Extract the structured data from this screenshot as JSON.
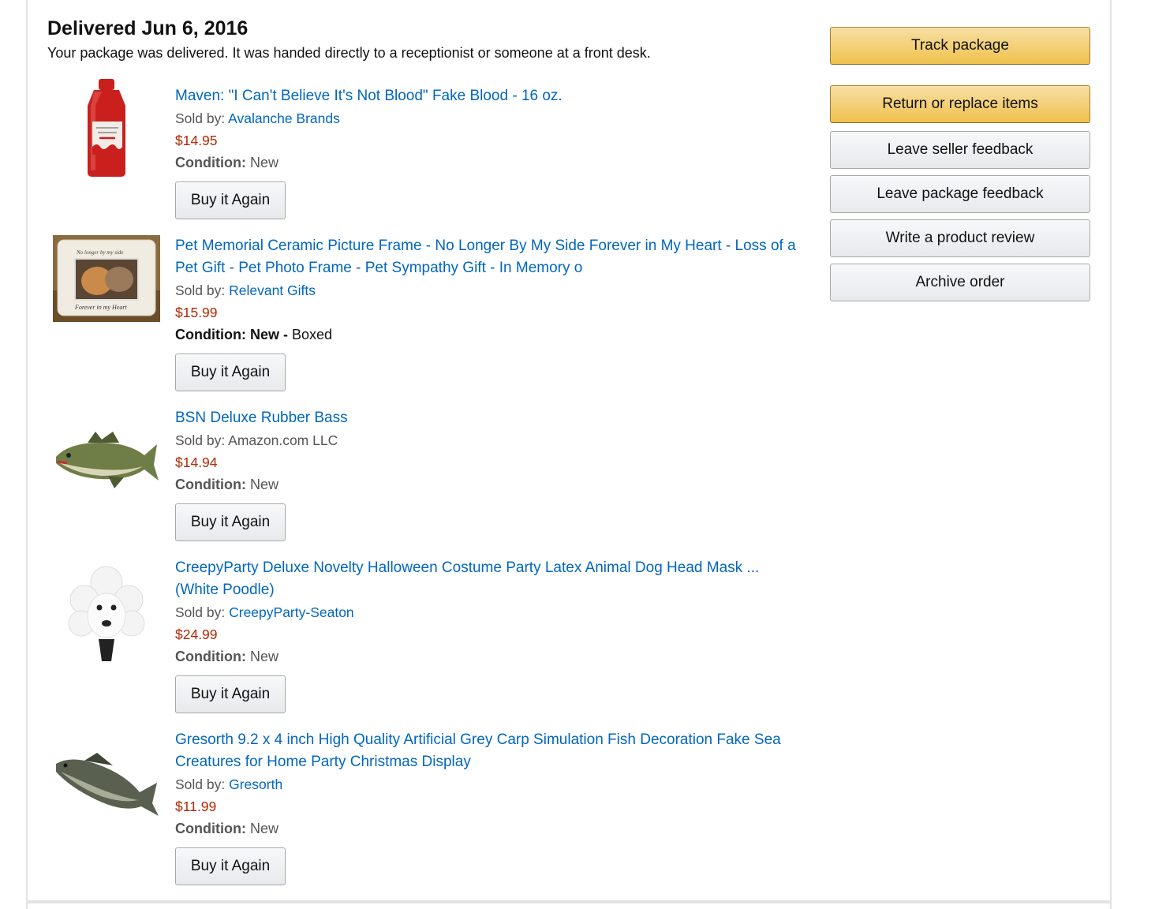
{
  "shipment": {
    "heading": "Delivered Jun 6, 2016",
    "subheading": "Your package was delivered. It was handed directly to a receptionist or someone at a front desk."
  },
  "actions": {
    "track": "Track package",
    "return": "Return or replace items",
    "seller_feedback": "Leave seller feedback",
    "package_feedback": "Leave package feedback",
    "review": "Write a product review",
    "archive": "Archive order"
  },
  "items": [
    {
      "title": "Maven: \"I Can't Believe It's Not Blood\" Fake Blood - 16 oz.",
      "sold_by_label": "Sold by:",
      "seller": "Avalanche Brands",
      "price": "$14.95",
      "condition_label": "Condition:",
      "condition": "New",
      "buy_label": "Buy it Again",
      "image_icon": "fake-blood-bottle"
    },
    {
      "title": "Pet Memorial Ceramic Picture Frame - No Longer By My Side Forever in My Heart - Loss of a Pet Gift - Pet Photo Frame - Pet Sympathy Gift - In Memory o",
      "sold_by_label": "Sold by:",
      "seller": "Relevant Gifts",
      "price": "$15.99",
      "condition_label": "Condition: New -",
      "condition": "Boxed",
      "buy_label": "Buy it Again",
      "image_icon": "picture-frame",
      "frame_text_top": "No longer by my side",
      "frame_text_bottom": "Forever in my Heart"
    },
    {
      "title": "BSN Deluxe Rubber Bass",
      "sold_by_label": "Sold by:",
      "seller": "Amazon.com LLC",
      "price": "$14.94",
      "condition_label": "Condition:",
      "condition": "New",
      "buy_label": "Buy it Again",
      "image_icon": "bass-fish"
    },
    {
      "title": "CreepyParty Deluxe Novelty Halloween Costume Party Latex Animal Dog Head Mask ... (White Poodle)",
      "sold_by_label": "Sold by:",
      "seller": "CreepyParty-Seaton",
      "price": "$24.99",
      "condition_label": "Condition:",
      "condition": "New",
      "buy_label": "Buy it Again",
      "image_icon": "poodle-mask"
    },
    {
      "title": "Gresorth 9.2 x 4 inch High Quality Artificial Grey Carp Simulation Fish Decoration Fake Sea Creatures for Home Party Christmas Display",
      "sold_by_label": "Sold by:",
      "seller": "Gresorth",
      "price": "$11.99",
      "condition_label": "Condition:",
      "condition": "New",
      "buy_label": "Buy it Again",
      "image_icon": "carp-fish"
    }
  ],
  "colors": {
    "link": "#0066c0",
    "price": "#b12704",
    "primary_button": "#f0c14b"
  }
}
